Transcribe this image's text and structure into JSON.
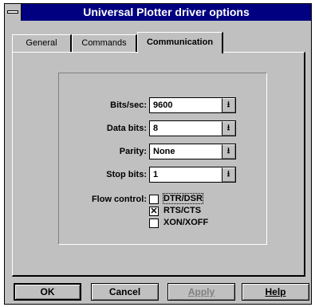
{
  "window": {
    "title": "Universal Plotter driver options"
  },
  "tabs": [
    {
      "label": "General"
    },
    {
      "label": "Commands"
    },
    {
      "label": "Communication",
      "active": true
    }
  ],
  "settings": {
    "bits_per_sec": {
      "label": "Bits/sec:",
      "value": "9600"
    },
    "data_bits": {
      "label": "Data bits:",
      "value": "8"
    },
    "parity": {
      "label": "Parity:",
      "value": "None"
    },
    "stop_bits": {
      "label": "Stop bits:",
      "value": "1"
    },
    "flow_control": {
      "label": "Flow control:",
      "options": [
        {
          "label": "DTR/DSR",
          "checked": false
        },
        {
          "label": "RTS/CTS",
          "checked": true
        },
        {
          "label": "XON/XOFF",
          "checked": false
        }
      ]
    }
  },
  "buttons": {
    "ok": "OK",
    "cancel": "Cancel",
    "apply": "Apply",
    "help": "Help"
  },
  "icons": {
    "dropdown_arrow": "dropdown-arrow-icon",
    "check": "checkmark-icon"
  }
}
